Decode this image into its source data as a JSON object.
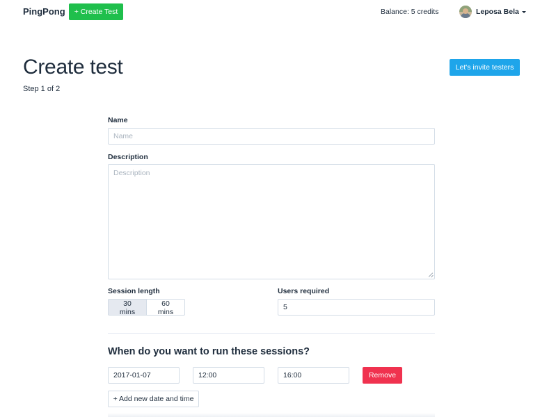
{
  "navbar": {
    "brand": "PingPong",
    "create_test_label": "+ Create Test",
    "balance": "Balance: 5 credits",
    "user_name": "Leposa Bela"
  },
  "header": {
    "title": "Create test",
    "step": "Step 1 of 2",
    "invite_label": "Let's invite testers"
  },
  "form": {
    "name_label": "Name",
    "name_placeholder": "Name",
    "name_value": "",
    "description_label": "Description",
    "description_placeholder": "Description",
    "description_value": "",
    "session_length_label": "Session length",
    "session_options": [
      "30 mins",
      "60 mins"
    ],
    "session_selected": "30 mins",
    "users_required_label": "Users required",
    "users_required_value": "5"
  },
  "schedule": {
    "title": "When do you want to run these sessions?",
    "rows": [
      {
        "date": "2017-01-07",
        "start": "12:00",
        "end": "16:00",
        "remove_label": "Remove"
      }
    ],
    "add_label": "+ Add new date and time"
  },
  "colors": {
    "create_button": "#1fbf4c",
    "invite_button": "#1ea5ea",
    "remove_button": "#f0324f"
  }
}
